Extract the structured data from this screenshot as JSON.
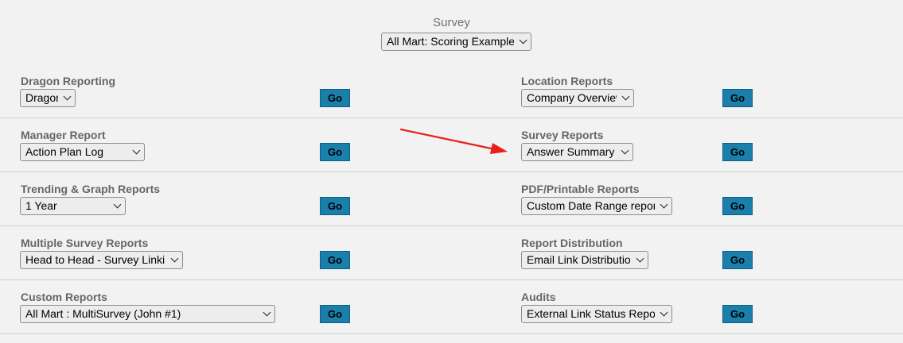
{
  "survey": {
    "label": "Survey",
    "selected": "All Mart: Scoring Examples"
  },
  "go_label": "Go",
  "rows": [
    {
      "left": {
        "title": "Dragon Reporting",
        "selected": "Dragon"
      },
      "right": {
        "title": "Location Reports",
        "selected": "Company Overview"
      }
    },
    {
      "left": {
        "title": "Manager Report",
        "selected": "Action Plan Log"
      },
      "right": {
        "title": "Survey Reports",
        "selected": "Answer Summary"
      }
    },
    {
      "left": {
        "title": "Trending & Graph Reports",
        "selected": "1 Year"
      },
      "right": {
        "title": "PDF/Printable Reports",
        "selected": "Custom Date Range reports"
      }
    },
    {
      "left": {
        "title": "Multiple Survey Reports",
        "selected": "Head to Head - Survey Linking"
      },
      "right": {
        "title": "Report Distribution",
        "selected": "Email Link Distribution"
      }
    },
    {
      "left": {
        "title": "Custom Reports",
        "selected": "All Mart : MultiSurvey (John #1)"
      },
      "right": {
        "title": "Audits",
        "selected": "External Link Status Report"
      }
    }
  ],
  "colors": {
    "background": "#f2f2f2",
    "go_button": "#1a7fab",
    "title_text": "#666666",
    "annotation_arrow": "#e8201a"
  }
}
